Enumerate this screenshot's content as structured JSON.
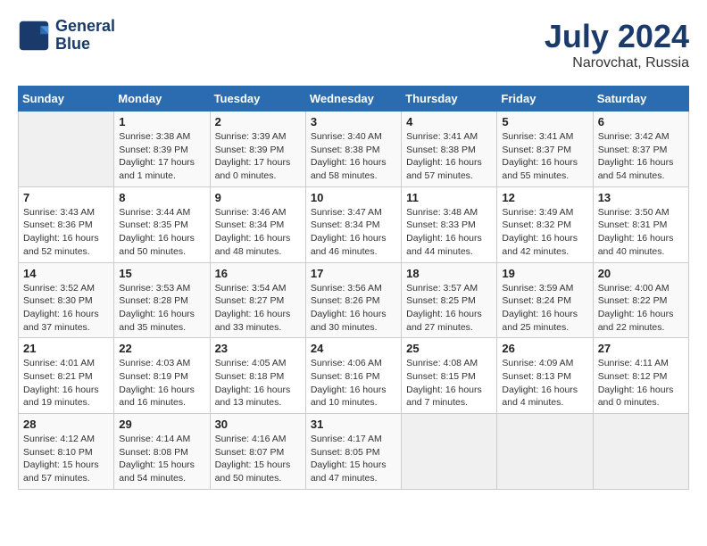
{
  "header": {
    "logo_line1": "General",
    "logo_line2": "Blue",
    "month": "July 2024",
    "location": "Narovchat, Russia"
  },
  "weekdays": [
    "Sunday",
    "Monday",
    "Tuesday",
    "Wednesday",
    "Thursday",
    "Friday",
    "Saturday"
  ],
  "weeks": [
    [
      {
        "day": "",
        "sunrise": "",
        "sunset": "",
        "daylight": ""
      },
      {
        "day": "1",
        "sunrise": "Sunrise: 3:38 AM",
        "sunset": "Sunset: 8:39 PM",
        "daylight": "Daylight: 17 hours and 1 minute."
      },
      {
        "day": "2",
        "sunrise": "Sunrise: 3:39 AM",
        "sunset": "Sunset: 8:39 PM",
        "daylight": "Daylight: 17 hours and 0 minutes."
      },
      {
        "day": "3",
        "sunrise": "Sunrise: 3:40 AM",
        "sunset": "Sunset: 8:38 PM",
        "daylight": "Daylight: 16 hours and 58 minutes."
      },
      {
        "day": "4",
        "sunrise": "Sunrise: 3:41 AM",
        "sunset": "Sunset: 8:38 PM",
        "daylight": "Daylight: 16 hours and 57 minutes."
      },
      {
        "day": "5",
        "sunrise": "Sunrise: 3:41 AM",
        "sunset": "Sunset: 8:37 PM",
        "daylight": "Daylight: 16 hours and 55 minutes."
      },
      {
        "day": "6",
        "sunrise": "Sunrise: 3:42 AM",
        "sunset": "Sunset: 8:37 PM",
        "daylight": "Daylight: 16 hours and 54 minutes."
      }
    ],
    [
      {
        "day": "7",
        "sunrise": "Sunrise: 3:43 AM",
        "sunset": "Sunset: 8:36 PM",
        "daylight": "Daylight: 16 hours and 52 minutes."
      },
      {
        "day": "8",
        "sunrise": "Sunrise: 3:44 AM",
        "sunset": "Sunset: 8:35 PM",
        "daylight": "Daylight: 16 hours and 50 minutes."
      },
      {
        "day": "9",
        "sunrise": "Sunrise: 3:46 AM",
        "sunset": "Sunset: 8:34 PM",
        "daylight": "Daylight: 16 hours and 48 minutes."
      },
      {
        "day": "10",
        "sunrise": "Sunrise: 3:47 AM",
        "sunset": "Sunset: 8:34 PM",
        "daylight": "Daylight: 16 hours and 46 minutes."
      },
      {
        "day": "11",
        "sunrise": "Sunrise: 3:48 AM",
        "sunset": "Sunset: 8:33 PM",
        "daylight": "Daylight: 16 hours and 44 minutes."
      },
      {
        "day": "12",
        "sunrise": "Sunrise: 3:49 AM",
        "sunset": "Sunset: 8:32 PM",
        "daylight": "Daylight: 16 hours and 42 minutes."
      },
      {
        "day": "13",
        "sunrise": "Sunrise: 3:50 AM",
        "sunset": "Sunset: 8:31 PM",
        "daylight": "Daylight: 16 hours and 40 minutes."
      }
    ],
    [
      {
        "day": "14",
        "sunrise": "Sunrise: 3:52 AM",
        "sunset": "Sunset: 8:30 PM",
        "daylight": "Daylight: 16 hours and 37 minutes."
      },
      {
        "day": "15",
        "sunrise": "Sunrise: 3:53 AM",
        "sunset": "Sunset: 8:28 PM",
        "daylight": "Daylight: 16 hours and 35 minutes."
      },
      {
        "day": "16",
        "sunrise": "Sunrise: 3:54 AM",
        "sunset": "Sunset: 8:27 PM",
        "daylight": "Daylight: 16 hours and 33 minutes."
      },
      {
        "day": "17",
        "sunrise": "Sunrise: 3:56 AM",
        "sunset": "Sunset: 8:26 PM",
        "daylight": "Daylight: 16 hours and 30 minutes."
      },
      {
        "day": "18",
        "sunrise": "Sunrise: 3:57 AM",
        "sunset": "Sunset: 8:25 PM",
        "daylight": "Daylight: 16 hours and 27 minutes."
      },
      {
        "day": "19",
        "sunrise": "Sunrise: 3:59 AM",
        "sunset": "Sunset: 8:24 PM",
        "daylight": "Daylight: 16 hours and 25 minutes."
      },
      {
        "day": "20",
        "sunrise": "Sunrise: 4:00 AM",
        "sunset": "Sunset: 8:22 PM",
        "daylight": "Daylight: 16 hours and 22 minutes."
      }
    ],
    [
      {
        "day": "21",
        "sunrise": "Sunrise: 4:01 AM",
        "sunset": "Sunset: 8:21 PM",
        "daylight": "Daylight: 16 hours and 19 minutes."
      },
      {
        "day": "22",
        "sunrise": "Sunrise: 4:03 AM",
        "sunset": "Sunset: 8:19 PM",
        "daylight": "Daylight: 16 hours and 16 minutes."
      },
      {
        "day": "23",
        "sunrise": "Sunrise: 4:05 AM",
        "sunset": "Sunset: 8:18 PM",
        "daylight": "Daylight: 16 hours and 13 minutes."
      },
      {
        "day": "24",
        "sunrise": "Sunrise: 4:06 AM",
        "sunset": "Sunset: 8:16 PM",
        "daylight": "Daylight: 16 hours and 10 minutes."
      },
      {
        "day": "25",
        "sunrise": "Sunrise: 4:08 AM",
        "sunset": "Sunset: 8:15 PM",
        "daylight": "Daylight: 16 hours and 7 minutes."
      },
      {
        "day": "26",
        "sunrise": "Sunrise: 4:09 AM",
        "sunset": "Sunset: 8:13 PM",
        "daylight": "Daylight: 16 hours and 4 minutes."
      },
      {
        "day": "27",
        "sunrise": "Sunrise: 4:11 AM",
        "sunset": "Sunset: 8:12 PM",
        "daylight": "Daylight: 16 hours and 0 minutes."
      }
    ],
    [
      {
        "day": "28",
        "sunrise": "Sunrise: 4:12 AM",
        "sunset": "Sunset: 8:10 PM",
        "daylight": "Daylight: 15 hours and 57 minutes."
      },
      {
        "day": "29",
        "sunrise": "Sunrise: 4:14 AM",
        "sunset": "Sunset: 8:08 PM",
        "daylight": "Daylight: 15 hours and 54 minutes."
      },
      {
        "day": "30",
        "sunrise": "Sunrise: 4:16 AM",
        "sunset": "Sunset: 8:07 PM",
        "daylight": "Daylight: 15 hours and 50 minutes."
      },
      {
        "day": "31",
        "sunrise": "Sunrise: 4:17 AM",
        "sunset": "Sunset: 8:05 PM",
        "daylight": "Daylight: 15 hours and 47 minutes."
      },
      {
        "day": "",
        "sunrise": "",
        "sunset": "",
        "daylight": ""
      },
      {
        "day": "",
        "sunrise": "",
        "sunset": "",
        "daylight": ""
      },
      {
        "day": "",
        "sunrise": "",
        "sunset": "",
        "daylight": ""
      }
    ]
  ]
}
